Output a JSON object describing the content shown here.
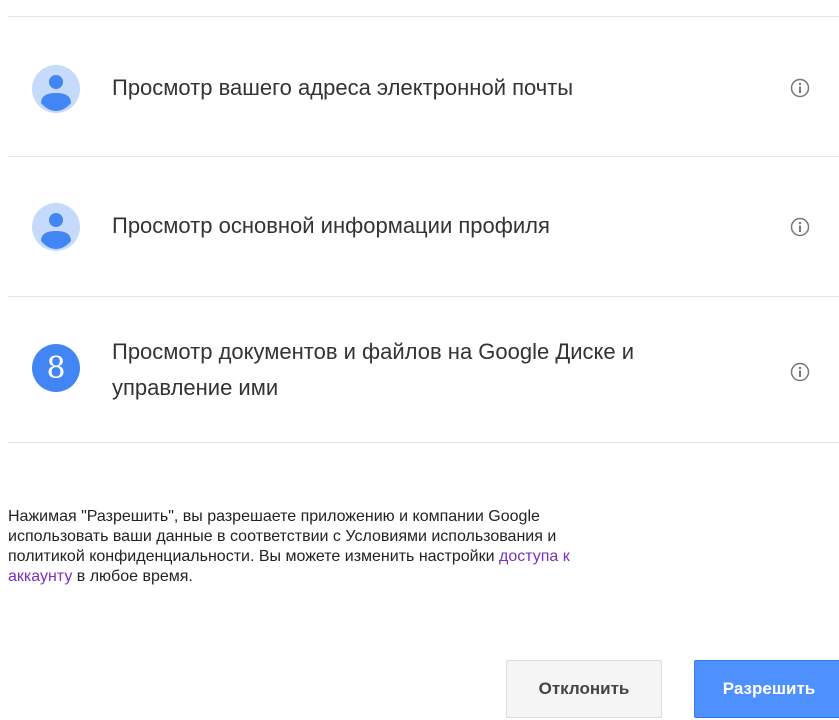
{
  "permissions": [
    {
      "text_line1": "Просмотр вашего адреса электронной почты",
      "text_line2": "",
      "icon": "person-icon"
    },
    {
      "text_line1": "Просмотр основной информации профиля",
      "text_line2": "",
      "icon": "person-icon"
    },
    {
      "text_line1": "Просмотр документов и файлов на Google Диске и",
      "text_line2": "управление ими",
      "icon": "google-plus-g-icon",
      "glyph": "8"
    }
  ],
  "consent": {
    "line1": "Нажимая \"Разрешить\", вы разрешаете приложению и компании Google",
    "line2": "использовать ваши данные в соответствии с Условиями использования и",
    "line3_text": "политикой конфиденциальности. Вы можете изменить настройки ",
    "link_part1": "доступа к",
    "link_part2": "аккаунту",
    "line4_text": " в любое время."
  },
  "buttons": {
    "deny_label": "Отклонить",
    "allow_label": "Разрешить"
  },
  "colors": {
    "allow_button": "#4d90fe",
    "deny_button": "#f5f5f5",
    "link": "#7a30c1",
    "avatar_light": "#c6dafc",
    "avatar_dark": "#4285f4",
    "google_icon": "#4285f4"
  }
}
